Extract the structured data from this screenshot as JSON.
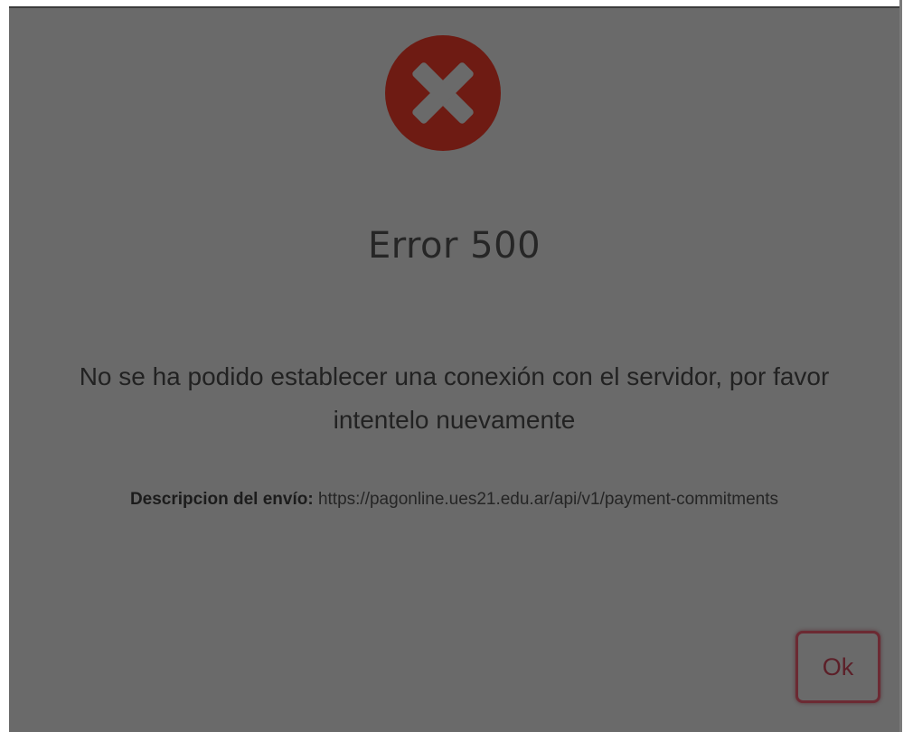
{
  "dialog": {
    "title": "Error 500",
    "message": "No se ha podido establecer una conexión con el servidor, por favor intentelo nuevamente",
    "description_label": "Descripcion del envío:",
    "description_value": " https://pagonline.ues21.edu.ar/api/v1/payment-commitments",
    "ok_label": "Ok"
  },
  "icons": {
    "status_icon": "error-x-circle-icon"
  },
  "colors": {
    "overlay": "#6a6a6a",
    "error_icon": "#6e1b13",
    "ok_border": "#6c2a33"
  }
}
